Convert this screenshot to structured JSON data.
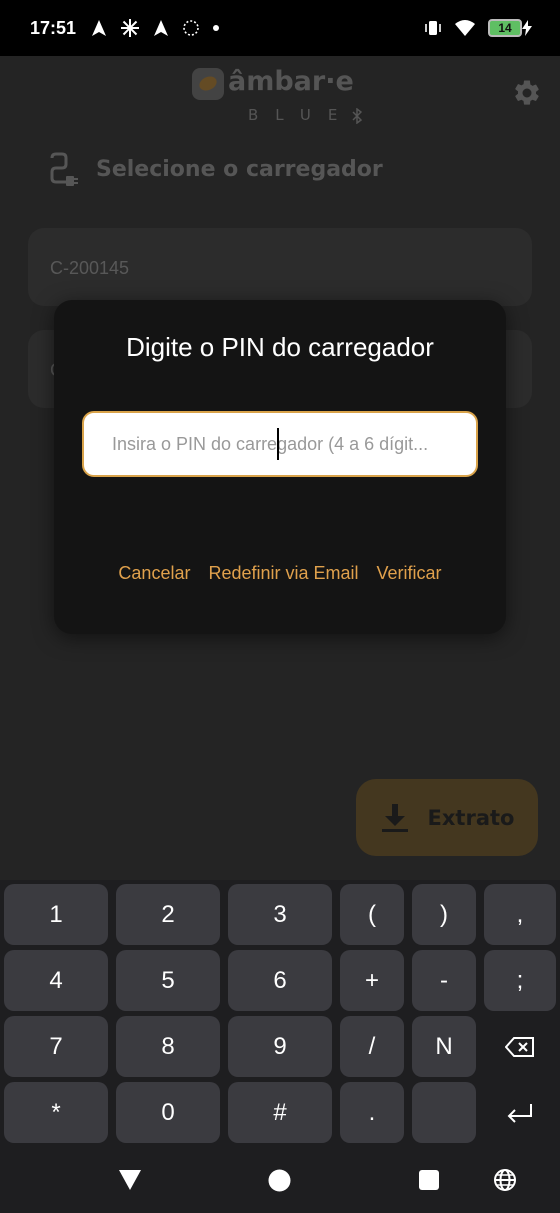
{
  "status_bar": {
    "time": "17:51",
    "battery_level": "14"
  },
  "app": {
    "logo_word": "âmbar·e",
    "logo_sub": "BLUE"
  },
  "page": {
    "section_title": "Selecione o carregador",
    "chargers": [
      "C-200145",
      "C"
    ]
  },
  "dialog": {
    "title": "Digite o PIN do carregador",
    "input_placeholder": "Insira o PIN do carregador (4 a 6 dígit...",
    "input_value": "",
    "actions": [
      "Cancelar",
      "Redefinir via Email",
      "Verificar"
    ]
  },
  "extrato_button": {
    "label": "Extrato"
  },
  "keyboard": {
    "rows": [
      [
        "1",
        "2",
        "3",
        "(",
        ")",
        ","
      ],
      [
        "4",
        "5",
        "6",
        "+",
        "-",
        ";"
      ],
      [
        "7",
        "8",
        "9",
        "/",
        "N",
        "backspace"
      ],
      [
        "*",
        "0",
        "#",
        ".",
        "",
        "enter"
      ]
    ]
  },
  "colors": {
    "accent": "#e0a14c",
    "extrato_bg": "#6e5a33",
    "dialog_bg": "#141414"
  }
}
